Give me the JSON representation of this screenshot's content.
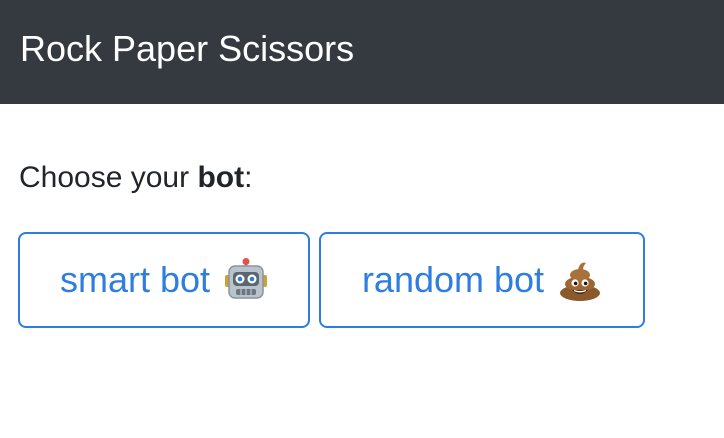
{
  "header": {
    "title": "Rock Paper Scissors"
  },
  "prompt": {
    "prefix": "Choose your ",
    "bold": "bot",
    "suffix": ":"
  },
  "bots": [
    {
      "label": "smart bot",
      "icon": "robot-face-icon"
    },
    {
      "label": "random bot",
      "icon": "pile-of-poo-icon"
    }
  ],
  "colors": {
    "navbar": "#343a40",
    "accent": "#2f7ddf",
    "text": "#212529"
  }
}
